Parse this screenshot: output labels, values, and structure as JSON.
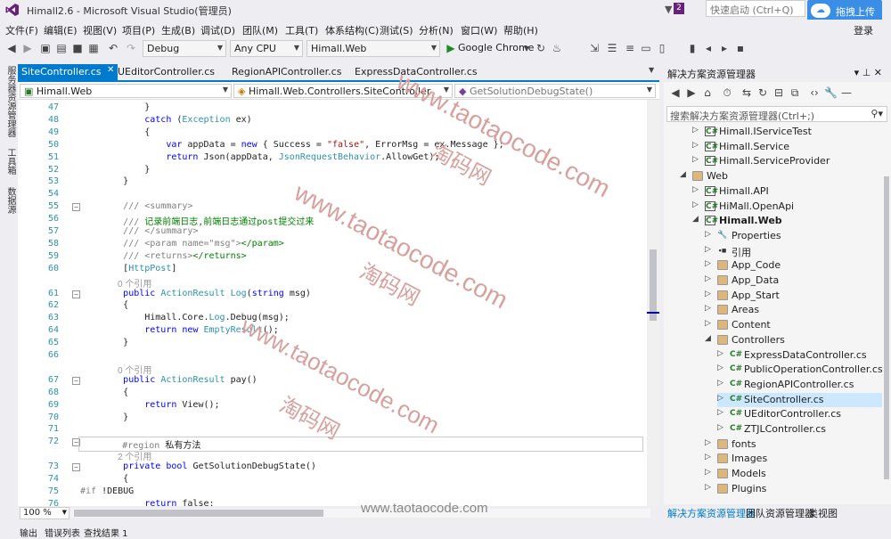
{
  "titlebar": {
    "title": "Himall2.6 - Microsoft Visual Studio(管理员)",
    "notif_count": "2",
    "quick_launch": "快速启动 (Ctrl+Q)",
    "upload_button": "拖拽上传",
    "login": "登录"
  },
  "menu": [
    "文件(F)",
    "编辑(E)",
    "视图(V)",
    "项目(P)",
    "生成(B)",
    "调试(D)",
    "团队(M)",
    "工具(T)",
    "体系结构(C)",
    "测试(S)",
    "分析(N)",
    "窗口(W)",
    "帮助(H)"
  ],
  "toolbar": {
    "config": "Debug",
    "platform": "Any CPU",
    "startup": "Himall.Web",
    "run_target": "Google Chrome"
  },
  "side_tabs": [
    "服务器资源管理器",
    "工具箱",
    "数据源"
  ],
  "doc_tabs": [
    "SiteController.cs",
    "UEditorController.cs",
    "RegionAPIController.cs",
    "ExpressDataController.cs"
  ],
  "navbar": {
    "project": "Himall.Web",
    "class": "Himall.Web.Controllers.SiteController",
    "member": "GetSolutionDebugState()"
  },
  "code": {
    "lines": [
      {
        "n": "47",
        "t": "            }"
      },
      {
        "n": "48",
        "t": "            catch (Exception ex)"
      },
      {
        "n": "49",
        "t": "            {"
      },
      {
        "n": "50",
        "t": "                var appData = new { Success = \"false\", ErrorMsg = ex.Message };"
      },
      {
        "n": "51",
        "t": "                return Json(appData, JsonRequestBehavior.AllowGet);"
      },
      {
        "n": "52",
        "t": "            }"
      },
      {
        "n": "53",
        "t": "        }"
      },
      {
        "n": "54",
        "t": ""
      },
      {
        "n": "55",
        "t": "        /// <summary>"
      },
      {
        "n": "56",
        "t": "        /// 记录前端日志,前端日志通过post提交过来"
      },
      {
        "n": "57",
        "t": "        /// </summary>"
      },
      {
        "n": "58",
        "t": "        /// <param name=\"msg\"></param>"
      },
      {
        "n": "59",
        "t": "        /// <returns></returns>"
      },
      {
        "n": "60",
        "t": "        [HttpPost]"
      },
      {
        "n": "",
        "t": "0 个引用"
      },
      {
        "n": "61",
        "t": "        public ActionResult Log(string msg)"
      },
      {
        "n": "62",
        "t": "        {"
      },
      {
        "n": "63",
        "t": "            Himall.Core.Log.Debug(msg);"
      },
      {
        "n": "64",
        "t": "            return new EmptyResult();"
      },
      {
        "n": "65",
        "t": "        }"
      },
      {
        "n": "66",
        "t": ""
      },
      {
        "n": "",
        "t": "0 个引用"
      },
      {
        "n": "67",
        "t": "        public ActionResult pay()"
      },
      {
        "n": "68",
        "t": "        {"
      },
      {
        "n": "69",
        "t": "            return View();"
      },
      {
        "n": "70",
        "t": "        }"
      },
      {
        "n": "71",
        "t": ""
      },
      {
        "n": "72",
        "t": "        #region 私有方法"
      },
      {
        "n": "",
        "t": "2 个引用"
      },
      {
        "n": "73",
        "t": "        private bool GetSolutionDebugState()"
      },
      {
        "n": "74",
        "t": "        {"
      },
      {
        "n": "75",
        "t": "#if !DEBUG"
      },
      {
        "n": "76",
        "t": "            return false;"
      }
    ]
  },
  "zoom": "100 %",
  "bottom_tabs": [
    "输出",
    "错误列表",
    "查找结果 1"
  ],
  "solution": {
    "title": "解决方案资源管理器",
    "search": "搜索解决方案资源管理器(Ctrl+;)",
    "items": [
      {
        "label": "Himall.IServiceTest",
        "exp": "▷",
        "icon": "proj"
      },
      {
        "label": "Himall.Service",
        "exp": "▷",
        "icon": "proj"
      },
      {
        "label": "Himall.ServiceProvider",
        "exp": "▷",
        "icon": "proj"
      },
      {
        "label": "Web",
        "exp": "◢",
        "icon": "fold"
      },
      {
        "label": "Himall.API",
        "exp": "▷",
        "icon": "proj"
      },
      {
        "label": "HiMall.OpenApi",
        "exp": "▷",
        "icon": "proj"
      },
      {
        "label": "Himall.Web",
        "exp": "◢",
        "icon": "proj"
      },
      {
        "label": "Properties",
        "exp": "▷",
        "icon": "wr"
      },
      {
        "label": "引用",
        "exp": "▷",
        "icon": "ref"
      },
      {
        "label": "App_Code",
        "exp": "▷",
        "icon": "fold"
      },
      {
        "label": "App_Data",
        "exp": "▷",
        "icon": "fold"
      },
      {
        "label": "App_Start",
        "exp": "▷",
        "icon": "fold"
      },
      {
        "label": "Areas",
        "exp": "▷",
        "icon": "fold"
      },
      {
        "label": "Content",
        "exp": "▷",
        "icon": "fold"
      },
      {
        "label": "Controllers",
        "exp": "◢",
        "icon": "fold"
      },
      {
        "label": "ExpressDataController.cs",
        "exp": "▷",
        "icon": "cs"
      },
      {
        "label": "PublicOperationController.cs",
        "exp": "▷",
        "icon": "cs"
      },
      {
        "label": "RegionAPIController.cs",
        "exp": "▷",
        "icon": "cs"
      },
      {
        "label": "SiteController.cs",
        "exp": "▷",
        "icon": "cs"
      },
      {
        "label": "UEditorController.cs",
        "exp": "▷",
        "icon": "cs"
      },
      {
        "label": "ZTJLController.cs",
        "exp": "▷",
        "icon": "cs"
      },
      {
        "label": "fonts",
        "exp": "▷",
        "icon": "fold"
      },
      {
        "label": "Images",
        "exp": "▷",
        "icon": "fold"
      },
      {
        "label": "Models",
        "exp": "▷",
        "icon": "fold"
      },
      {
        "label": "Plugins",
        "exp": "▷",
        "icon": "fold"
      }
    ],
    "bottom_tabs": [
      "解决方案资源管理器",
      "团队资源管理器",
      "类视图"
    ]
  },
  "watermarks": {
    "url": "www.taotaocode.com",
    "cn": "淘码网"
  },
  "colors": {
    "accent": "#007acc",
    "vs_purple": "#68217a"
  }
}
